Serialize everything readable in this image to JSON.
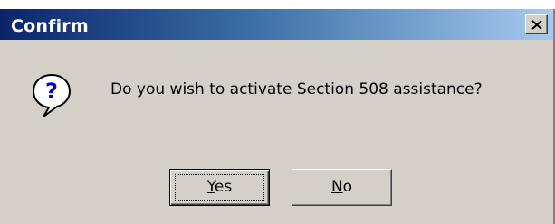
{
  "dialog": {
    "title": "Confirm",
    "message": "Do you wish to activate Section 508 assistance?",
    "icon": "question-icon"
  },
  "buttons": {
    "yes_mnemonic": "Y",
    "yes_rest": "es",
    "no_mnemonic": "N",
    "no_rest": "o"
  },
  "colors": {
    "titlebar_start": "#0a246a",
    "titlebar_end": "#a6caf0",
    "dialog_background": "#d4d0c8"
  }
}
